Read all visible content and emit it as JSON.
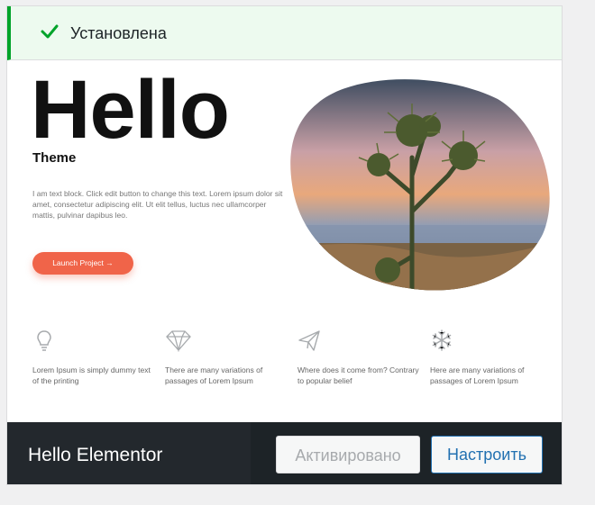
{
  "notice": {
    "text": "Установлена",
    "icon": "check-icon",
    "color": "#00a32a"
  },
  "preview": {
    "title": "Hello",
    "subtitle": "Theme",
    "body": "I am text block. Click edit button to change this text. Lorem ipsum dolor sit amet, consectetur adipiscing elit. Ut elit tellus, luctus nec ullamcorper mattis, pulvinar dapibus leo.",
    "button_label": "Launch Project  →",
    "button_color": "#f06449",
    "features": [
      {
        "icon": "lightbulb-icon",
        "text": "Lorem Ipsum is simply dummy text of the printing"
      },
      {
        "icon": "diamond-icon",
        "text": "There are many variations of passages of Lorem Ipsum"
      },
      {
        "icon": "paper-plane-icon",
        "text": "Where does it come from? Contrary to popular belief"
      },
      {
        "icon": "snowflake-icon",
        "text": "Here are many variations of passages of Lorem Ipsum"
      }
    ]
  },
  "footer": {
    "theme_name": "Hello Elementor",
    "active_label": "Активировано",
    "customize_label": "Настроить",
    "accent": "#2271b1"
  }
}
